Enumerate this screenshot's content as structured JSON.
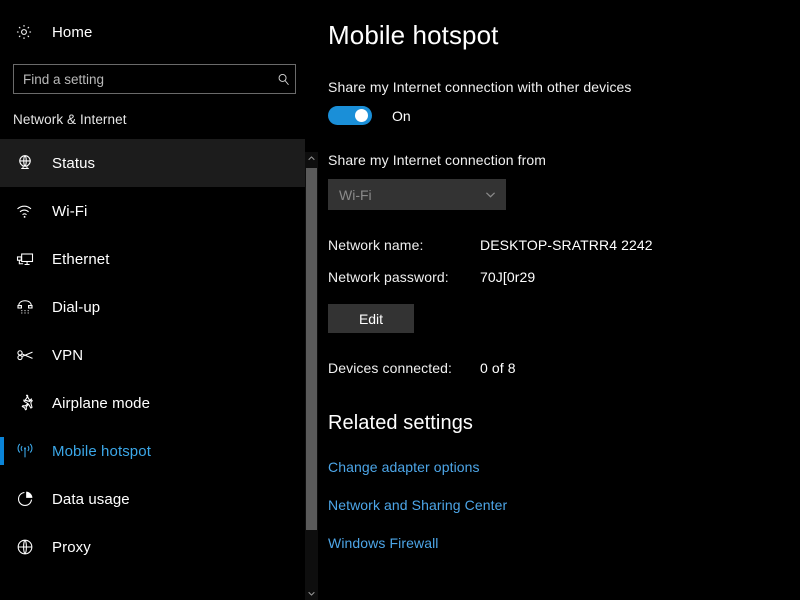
{
  "sidebar": {
    "home": {
      "label": "Home",
      "icon": "gear-icon"
    },
    "search": {
      "placeholder": "Find a setting",
      "value": "",
      "icon": "search-icon"
    },
    "category": "Network & Internet",
    "items": [
      {
        "label": "Status",
        "icon": "network-status-icon",
        "state": "hover"
      },
      {
        "label": "Wi-Fi",
        "icon": "wifi-icon",
        "state": "normal"
      },
      {
        "label": "Ethernet",
        "icon": "ethernet-icon",
        "state": "normal"
      },
      {
        "label": "Dial-up",
        "icon": "dialup-phone-icon",
        "state": "normal"
      },
      {
        "label": "VPN",
        "icon": "vpn-key-icon",
        "state": "normal"
      },
      {
        "label": "Airplane mode",
        "icon": "airplane-icon",
        "state": "normal"
      },
      {
        "label": "Mobile hotspot",
        "icon": "hotspot-icon",
        "state": "selected"
      },
      {
        "label": "Data usage",
        "icon": "pie-chart-icon",
        "state": "normal"
      },
      {
        "label": "Proxy",
        "icon": "globe-icon",
        "state": "normal"
      }
    ],
    "scrollbar": {
      "up_icon": "chevron-up-icon",
      "down_icon": "chevron-down-icon"
    }
  },
  "main": {
    "title": "Mobile hotspot",
    "share_label": "Share my Internet connection with other devices",
    "toggle": {
      "state_label": "On",
      "on": true
    },
    "share_from_label": "Share my Internet connection from",
    "share_from_select": {
      "value": "Wi-Fi",
      "disabled": true,
      "icon": "chevron-down-icon"
    },
    "details": [
      {
        "key": "Network name:",
        "value": "DESKTOP-SRATRR4 2242"
      },
      {
        "key": "Network password:",
        "value": "70J[0r29"
      }
    ],
    "edit_button": "Edit",
    "devices": {
      "key": "Devices connected:",
      "value": "0 of 8"
    },
    "related": {
      "title": "Related settings",
      "links": [
        "Change adapter options",
        "Network and Sharing Center",
        "Windows Firewall"
      ]
    }
  },
  "colors": {
    "accent": "#0a84d8",
    "toggle_on": "#1a8fd8",
    "link": "#4da6e8",
    "selected_text": "#3ba7e8",
    "background": "#000000",
    "control": "#333333"
  }
}
